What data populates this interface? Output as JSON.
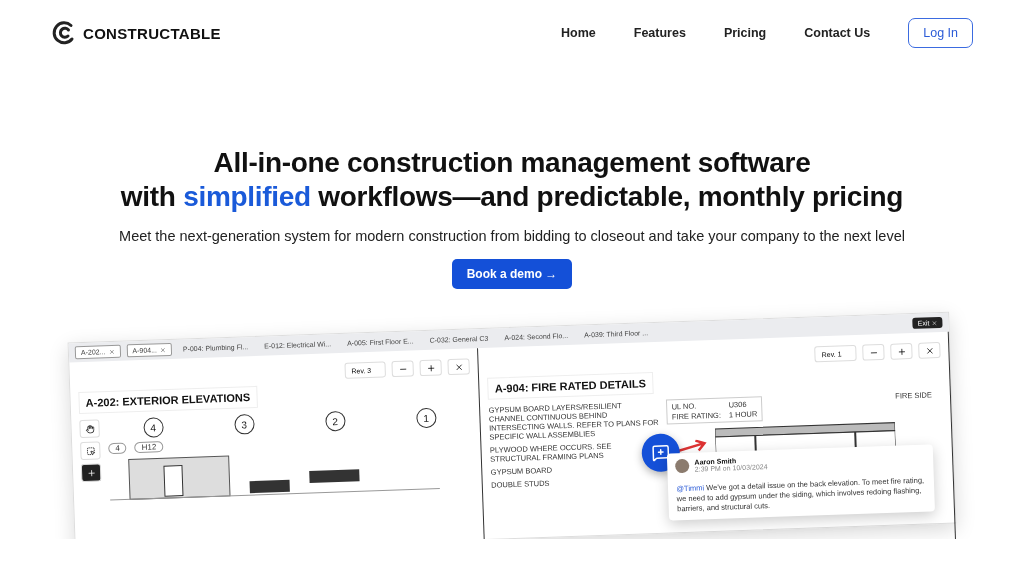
{
  "nav": {
    "brand": "CONSTRUCTABLE",
    "links": [
      "Home",
      "Features",
      "Pricing",
      "Contact Us"
    ],
    "login": "Log In"
  },
  "hero": {
    "lines": [
      [
        {
          "text": "All-in-one construction management software",
          "highlight": false
        }
      ],
      [
        {
          "text": "with ",
          "highlight": false
        },
        {
          "text": "simplified",
          "highlight": true
        },
        {
          "text": " workflows—and predictable, monthly pricing",
          "highlight": false
        }
      ]
    ],
    "subtitle": "Meet the next-generation system for modern construction from bidding to closeout and take your company to the next level",
    "cta": "Book a demo →"
  },
  "mockup": {
    "tabs": [
      {
        "label": "A-202...",
        "kind": "chip"
      },
      {
        "label": "A-904...",
        "kind": "chip"
      },
      {
        "label": "P-004: Plumbing Fl...",
        "kind": "plain"
      },
      {
        "label": "E-012: Electrical Wi...",
        "kind": "plain"
      },
      {
        "label": "A-005: First Floor E...",
        "kind": "plain"
      },
      {
        "label": "C-032: General C3",
        "kind": "plain"
      },
      {
        "label": "A-024: Second Flo...",
        "kind": "plain"
      },
      {
        "label": "A-039: Third Floor ...",
        "kind": "plain"
      }
    ],
    "exit": "Exit",
    "left": {
      "revision": "Rev. 3",
      "title": "A-202: EXTERIOR ELEVATIONS",
      "gridlines": [
        "4",
        "3",
        "2",
        "1"
      ],
      "tag": "4",
      "level_mark": "H12"
    },
    "right": {
      "revision": "Rev. 1",
      "title": "A-904: FIRE RATED DETAILS",
      "notes": [
        "GYPSUM BOARD LAYERS/RESILIENT CHANNEL CONTINUOUS BEHIND INTERSECTING WALLS. REFER TO PLANS FOR SPECIFIC WALL ASSEMBLIES",
        "PLYWOOD WHERE OCCURS. SEE STRUCTURAL FRAMING PLANS",
        "GYPSUM BOARD",
        "DOUBLE STUDS"
      ],
      "spec": [
        {
          "label": "UL NO.",
          "value": "U306"
        },
        {
          "label": "FIRE RATING:",
          "value": "1 HOUR"
        }
      ],
      "side_label": "FIRE SIDE",
      "comment": {
        "author": "Aaron Smith",
        "time": "2:39 PM on 10/03/2024",
        "mention": "@Timmi",
        "text": " We've got a detail issue on the back elevation. To meet fire rating, we need to add gypsum under the siding, which involves redoing flashing, barriers, and structural cuts."
      }
    }
  }
}
